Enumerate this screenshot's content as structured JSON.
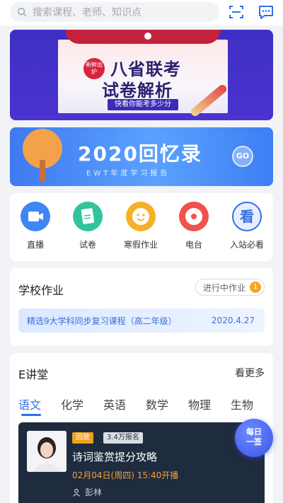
{
  "search": {
    "placeholder": "搜索课程、老师、知识点"
  },
  "banner1": {
    "badge": "新鲜出炉",
    "title_line1": "八省联考",
    "title_line2": "试卷解析",
    "subtitle": "快看你能考多少分"
  },
  "banner2": {
    "title": "2020回忆录",
    "subtitle": "EWT年度学习报告",
    "button": "GO"
  },
  "menu": {
    "items": [
      {
        "label": "直播",
        "icon": "live-video-icon",
        "color": "#3f86f5"
      },
      {
        "label": "试卷",
        "icon": "exam-paper-icon",
        "color": "#2fc59a"
      },
      {
        "label": "寒假作业",
        "icon": "smile-face-icon",
        "color": "#f6b026"
      },
      {
        "label": "电台",
        "icon": "radio-disc-icon",
        "color": "#f0524f"
      },
      {
        "label": "入站必看",
        "icon": "must-see-icon",
        "color": "#3a6fe0"
      }
    ]
  },
  "homework": {
    "title": "学校作业",
    "status_label": "进行中作业",
    "status_count": "1",
    "item_title": "精选9大学科同步复习课程（高二年级）",
    "item_date": "2020.4.27"
  },
  "lecture": {
    "title": "E讲堂",
    "more": "看更多",
    "tabs": [
      "语文",
      "化学",
      "英语",
      "数学",
      "物理",
      "生物"
    ],
    "course": {
      "tag": "回放",
      "enrolled": "3.4万报名",
      "title": "诗词鉴赏提分攻略",
      "time": "02月04日(周四) 15:40开播",
      "teacher": "彭林"
    }
  },
  "checkin": {
    "line1": "每日",
    "line2": "一签"
  },
  "colors": {
    "accent": "#2f6ff0",
    "banner1_bg": "#3e2fc4",
    "banner2_bg": "#3f79f0",
    "course_bg": "#1f2b3e"
  }
}
